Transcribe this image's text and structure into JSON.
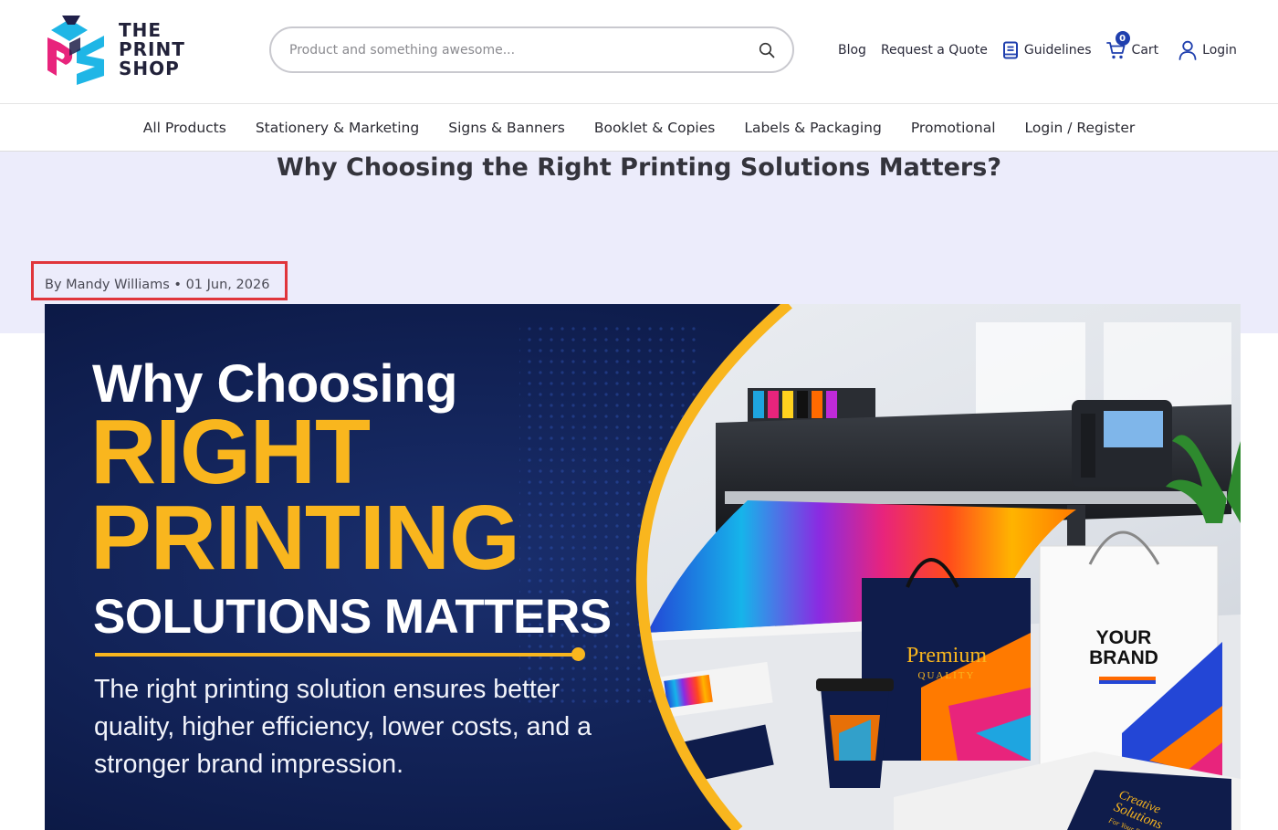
{
  "brand": {
    "logo_lines": [
      "THE",
      "PRINT",
      "SHOP"
    ],
    "logo_colors": {
      "cyan": "#1fb6e6",
      "magenta": "#e8247c",
      "navy": "#20204a"
    }
  },
  "search": {
    "placeholder": "Product and something awesome...",
    "icon": "search-icon"
  },
  "top_links": {
    "blog": "Blog",
    "quote": "Request a Quote",
    "guidelines": "Guidelines",
    "cart": "Cart",
    "cart_count": "0",
    "login": "Login"
  },
  "nav": {
    "items": [
      "All Products",
      "Stationery & Marketing",
      "Signs & Banners",
      "Booklet & Copies",
      "Labels & Packaging",
      "Promotional",
      "Login / Register"
    ]
  },
  "post": {
    "title": "Why Choosing the Right Printing Solutions Matters?",
    "meta": "By Mandy Williams • 01 Jun, 2026",
    "highlight_color": "#e0353b",
    "band_color": "#ececfb"
  },
  "banner": {
    "line1": "Why Choosing",
    "line2": "RIGHT",
    "line3": "PRINTING",
    "line4": "SOLUTIONS MATTERS",
    "body": "The right printing solution ensures better quality, higher efficiency, lower costs, and a stronger brand impression.",
    "bag_brand_1": "YOUR",
    "bag_brand_2": "BRAND",
    "box_title": "Premium",
    "box_subtitle": "QUALITY",
    "magazine_1": "Creative",
    "magazine_2": "Solutions",
    "magazine_3": "For Your Business",
    "accent_color": "#f9b61e",
    "navy_color": "#0d1b45"
  }
}
